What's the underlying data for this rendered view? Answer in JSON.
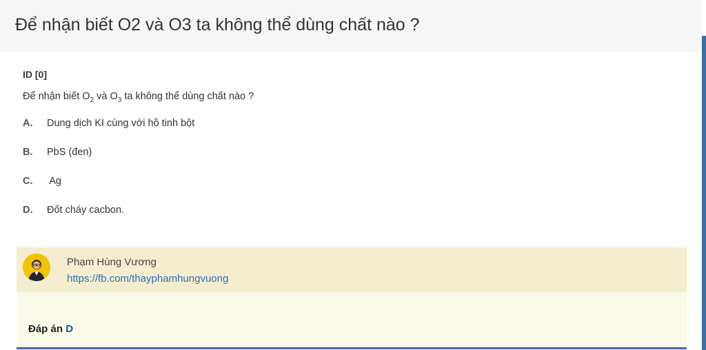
{
  "page": {
    "title": "Để nhận biết O2 và O3 ta không thể dùng chất nào ?"
  },
  "question": {
    "id_label": "ID [0]",
    "text_prefix": "Để nhận biết O",
    "o2_sub": "2",
    "text_mid": " và O",
    "o3_sub": "3",
    "text_suffix": " ta không thể dùng chất nào ?",
    "options": [
      {
        "letter": "A.",
        "text": "Dung dịch KI cùng với hồ tinh bột"
      },
      {
        "letter": "B.",
        "text": "PbS (đen)"
      },
      {
        "letter": "C.",
        "text": " Ag"
      },
      {
        "letter": "D.",
        "text": "Đốt cháy cacbon."
      }
    ]
  },
  "author": {
    "name": "Phạm Hùng Vương",
    "link": "https://fb.com/thayphamhungvuong",
    "avatar_icon": "person-avatar-icon"
  },
  "answer": {
    "label": "Đáp án ",
    "value": "D"
  },
  "colors": {
    "header_bg": "#f6f6f6",
    "author_bg": "#f4edcf",
    "answer_bg": "#fafae8",
    "link": "#2a6fb5",
    "answer_value": "#1f4fb5",
    "accent_bar": "#3a6ea5"
  }
}
